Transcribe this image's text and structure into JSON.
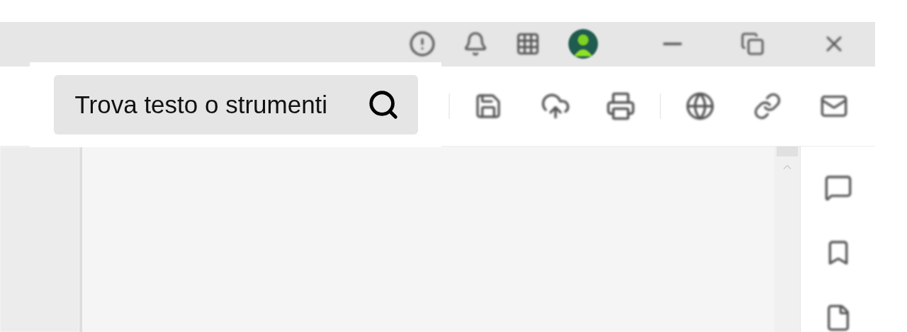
{
  "search": {
    "label": "Trova testo o strumenti"
  }
}
